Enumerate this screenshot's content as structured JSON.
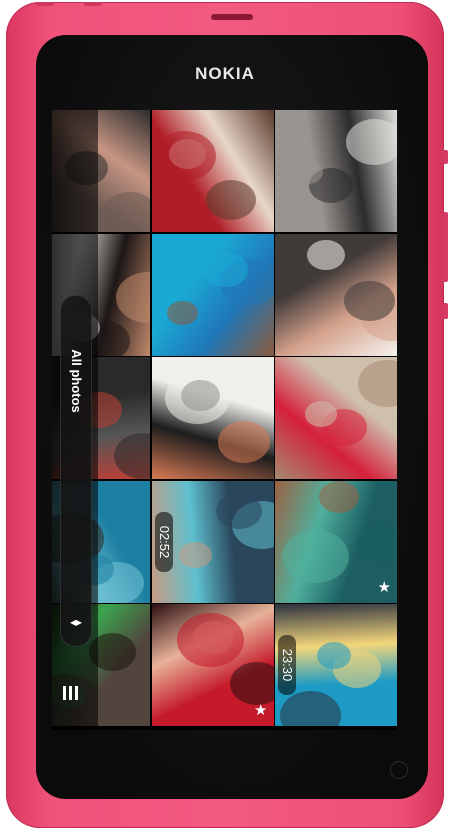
{
  "device": {
    "brand": "NOKIA"
  },
  "gallery": {
    "view_title": "All photos",
    "thumbnails": [
      {
        "row": 0,
        "col": 0,
        "colors": [
          "#6e5b54",
          "#c69583",
          "#2d2d2d"
        ],
        "overlay": ""
      },
      {
        "row": 0,
        "col": 1,
        "colors": [
          "#b01d26",
          "#e8d7c9",
          "#5a3a2c"
        ],
        "overlay": ""
      },
      {
        "row": 0,
        "col": 2,
        "colors": [
          "#9a9490",
          "#2b2b2b",
          "#e2e2df"
        ],
        "overlay": ""
      },
      {
        "row": 1,
        "col": 0,
        "colors": [
          "#d9d7d2",
          "#1d1616",
          "#c18a6b"
        ],
        "overlay": ""
      },
      {
        "row": 1,
        "col": 1,
        "colors": [
          "#1aa9d5",
          "#2077b7",
          "#8b5a3c"
        ],
        "overlay": ""
      },
      {
        "row": 1,
        "col": 2,
        "colors": [
          "#403a39",
          "#d4a18b",
          "#f6f2ee"
        ],
        "overlay": ""
      },
      {
        "row": 2,
        "col": 0,
        "colors": [
          "#2a2a2a",
          "#565656",
          "#bf3f35"
        ],
        "overlay": ""
      },
      {
        "row": 2,
        "col": 1,
        "colors": [
          "#f0efeb",
          "#1d1d1d",
          "#d97a55"
        ],
        "overlay": ""
      },
      {
        "row": 2,
        "col": 2,
        "colors": [
          "#cfbfad",
          "#d5203b",
          "#a58a6f"
        ],
        "overlay": ""
      },
      {
        "row": 3,
        "col": 0,
        "colors": [
          "#1d7fa2",
          "#74c5d5",
          "#322720"
        ],
        "overlay": ""
      },
      {
        "row": 3,
        "col": 1,
        "colors": [
          "#2a465b",
          "#5ec0cf",
          "#c89b82"
        ],
        "overlay": "video"
      },
      {
        "row": 3,
        "col": 2,
        "colors": [
          "#1c5e62",
          "#4fb09d",
          "#9d6143"
        ],
        "overlay": "favorite"
      },
      {
        "row": 4,
        "col": 0,
        "colors": [
          "#51453e",
          "#3aa54e",
          "#1d140f"
        ],
        "overlay": ""
      },
      {
        "row": 4,
        "col": 1,
        "colors": [
          "#c41a29",
          "#e8b299",
          "#2b0f11"
        ],
        "overlay": "favorite"
      },
      {
        "row": 4,
        "col": 2,
        "colors": [
          "#1d9bc4",
          "#f3d67b",
          "#2c3140"
        ],
        "overlay": "video"
      }
    ],
    "video_durations": [
      "02:52",
      "23:30"
    ]
  },
  "icons": {
    "scroll": "up-down-arrows-icon",
    "menu": "menu-icon",
    "favorite": "star-icon",
    "home": "home-button-icon"
  }
}
